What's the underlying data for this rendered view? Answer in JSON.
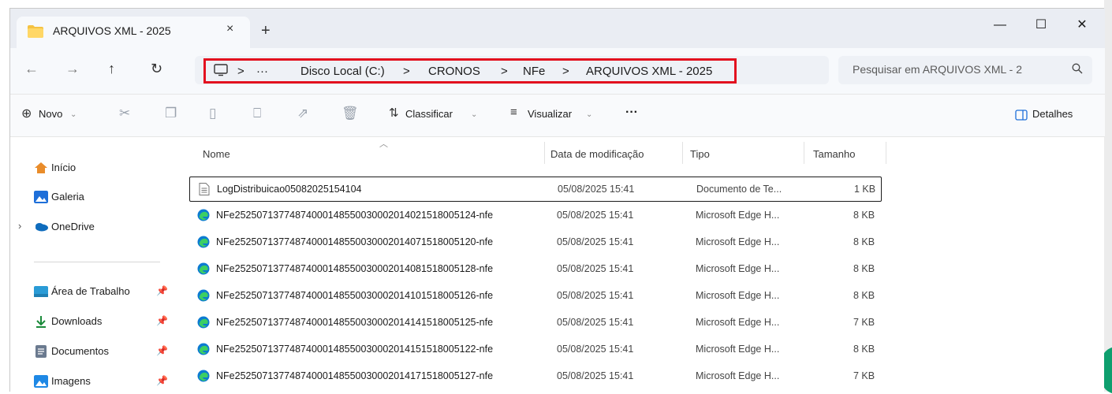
{
  "window": {
    "tab_title": "ARQUIVOS XML - 2025",
    "new_tab": "+",
    "close_tab": "×",
    "minimize": "—",
    "maximize": "☐",
    "close": "✕"
  },
  "nav": {
    "back": "←",
    "forward": "→",
    "up": "↑",
    "refresh": "↻"
  },
  "breadcrumb": {
    "more": "···",
    "items": [
      "Disco Local (C:)",
      "CRONOS",
      "NFe",
      "ARQUIVOS XML - 2025"
    ],
    "separator": ">"
  },
  "search": {
    "placeholder": "Pesquisar em ARQUIVOS XML - 2"
  },
  "toolbar": {
    "new_label": "Novo",
    "sort_label": "Classificar",
    "view_label": "Visualizar",
    "more_label": "···",
    "details_label": "Detalhes"
  },
  "sidebar": {
    "items": [
      {
        "label": "Início",
        "icon": "home-icon",
        "color": "#e98c2a"
      },
      {
        "label": "Galeria",
        "icon": "gallery-icon",
        "color": "#1e6fd9"
      },
      {
        "label": "OneDrive",
        "icon": "onedrive-icon",
        "color": "#0f6cbd"
      },
      {
        "label": "Área de Trabalho",
        "icon": "desktop-icon",
        "color": "#2a9bd6"
      },
      {
        "label": "Downloads",
        "icon": "download-icon",
        "color": "#1a8a3a"
      },
      {
        "label": "Documentos",
        "icon": "documents-icon",
        "color": "#6b7a8f"
      },
      {
        "label": "Imagens",
        "icon": "pictures-icon",
        "color": "#1e88e5"
      }
    ]
  },
  "columns": {
    "name": "Nome",
    "modified": "Data de modificação",
    "type": "Tipo",
    "size": "Tamanho"
  },
  "files": [
    {
      "name": "LogDistribuicao05082025154104",
      "modified": "05/08/2025 15:41",
      "type": "Documento de Te...",
      "size": "1 KB",
      "icon": "text-file-icon"
    },
    {
      "name": "NFe25250713774874000148550030002014021518005124-nfe",
      "modified": "05/08/2025 15:41",
      "type": "Microsoft Edge H...",
      "size": "8 KB",
      "icon": "edge-icon"
    },
    {
      "name": "NFe25250713774874000148550030002014071518005120-nfe",
      "modified": "05/08/2025 15:41",
      "type": "Microsoft Edge H...",
      "size": "8 KB",
      "icon": "edge-icon"
    },
    {
      "name": "NFe25250713774874000148550030002014081518005128-nfe",
      "modified": "05/08/2025 15:41",
      "type": "Microsoft Edge H...",
      "size": "8 KB",
      "icon": "edge-icon"
    },
    {
      "name": "NFe25250713774874000148550030002014101518005126-nfe",
      "modified": "05/08/2025 15:41",
      "type": "Microsoft Edge H...",
      "size": "8 KB",
      "icon": "edge-icon"
    },
    {
      "name": "NFe25250713774874000148550030002014141518005125-nfe",
      "modified": "05/08/2025 15:41",
      "type": "Microsoft Edge H...",
      "size": "7 KB",
      "icon": "edge-icon"
    },
    {
      "name": "NFe25250713774874000148550030002014151518005122-nfe",
      "modified": "05/08/2025 15:41",
      "type": "Microsoft Edge H...",
      "size": "8 KB",
      "icon": "edge-icon"
    },
    {
      "name": "NFe25250713774874000148550030002014171518005127-nfe",
      "modified": "05/08/2025 15:41",
      "type": "Microsoft Edge H...",
      "size": "7 KB",
      "icon": "edge-icon"
    }
  ],
  "colors": {
    "highlight_border": "#e3111f",
    "titlebar": "#eaedf3",
    "folder": "#f5c242"
  }
}
